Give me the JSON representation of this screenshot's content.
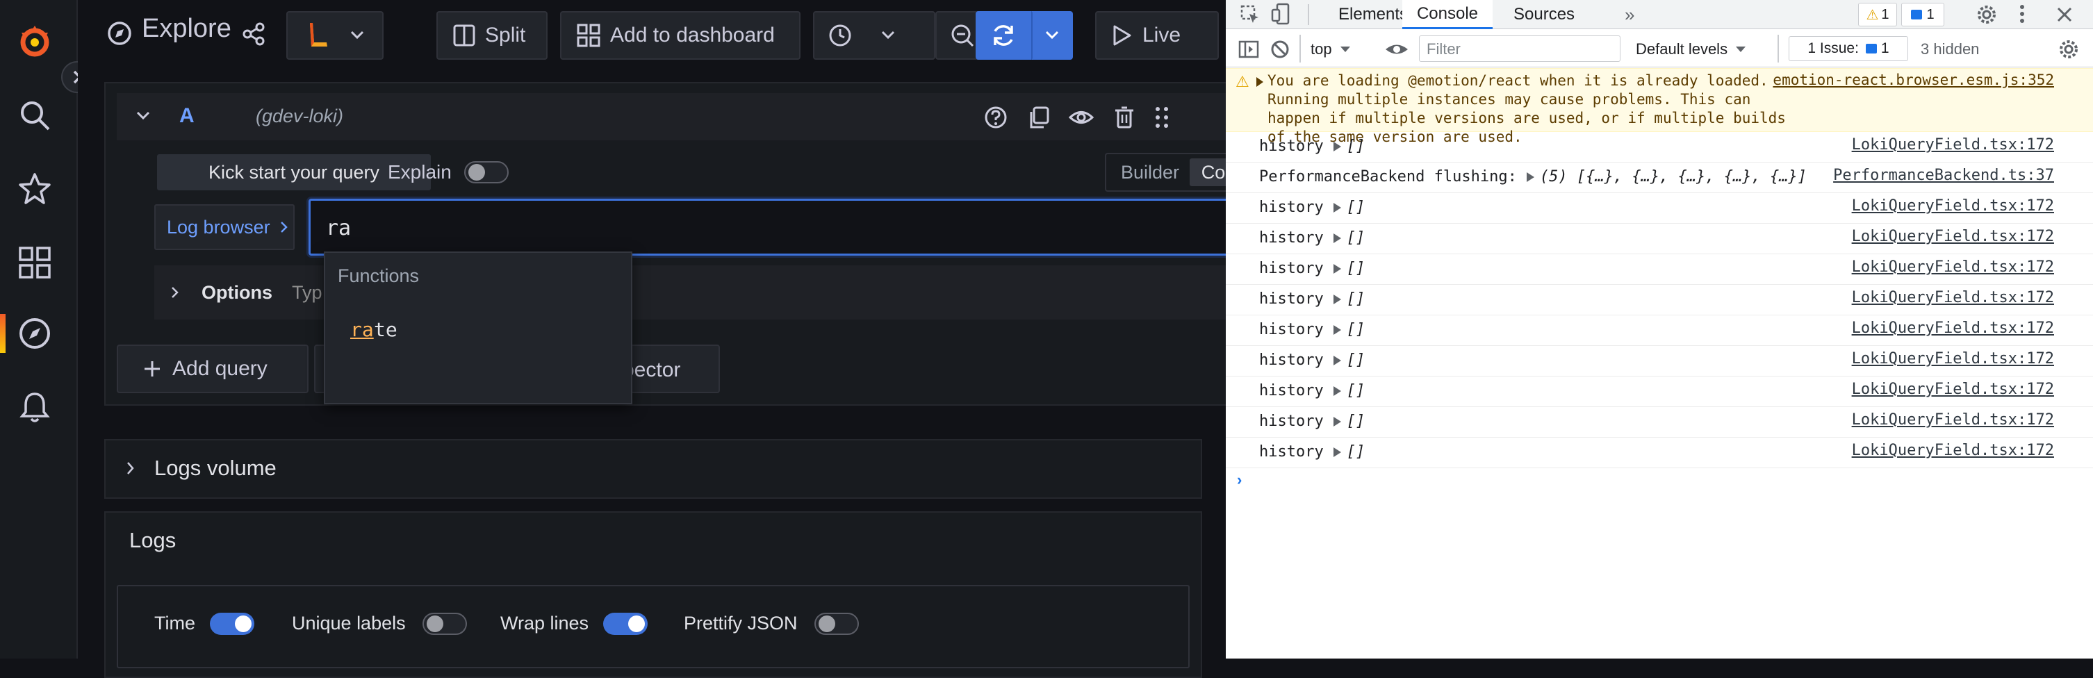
{
  "explore": {
    "title": "Explore",
    "datasource_icon": "loki-logo-icon",
    "split_label": "Split",
    "add_to_dashboard_label": "Add to dashboard",
    "live_label": "Live"
  },
  "query": {
    "ref_id": "A",
    "datasource": "(gdev-loki)",
    "kick_start_label": "Kick start your query",
    "explain_label": "Explain",
    "explain_on": false,
    "builder_label": "Builder",
    "code_label": "Code",
    "log_browser_label": "Log browser",
    "input_value": "ra",
    "options_label": "Options",
    "options_hint": "Typ",
    "add_query_label": "Add query",
    "inspector_label_tail": "pector"
  },
  "autocomplete": {
    "group": "Functions",
    "item_match": "ra",
    "item_rest": "te"
  },
  "logs_volume": {
    "label": "Logs volume"
  },
  "logs": {
    "title": "Logs",
    "options": [
      {
        "label": "Time",
        "on": true
      },
      {
        "label": "Unique labels",
        "on": false
      },
      {
        "label": "Wrap lines",
        "on": true
      },
      {
        "label": "Prettify JSON",
        "on": false
      }
    ]
  },
  "devtools": {
    "tabs": [
      "Elements",
      "Console",
      "Sources"
    ],
    "active_tab": "Console",
    "more_tabs": "»",
    "warning_count": "1",
    "message_count": "1",
    "context": "top",
    "filter_placeholder": "Filter",
    "levels": "Default levels",
    "issues_label": "1 Issue:",
    "issues_count": "1",
    "hidden": "3 hidden",
    "warning_text": "You are loading @emotion/react when it is already loaded. Running multiple instances may cause problems. This can happen if multiple versions are used, or if multiple builds of the same version are used.",
    "warning_source": "emotion-react.browser.esm.js:352",
    "logs": [
      {
        "label": "history",
        "value": "[]",
        "source": "LokiQueryField.tsx:172"
      },
      {
        "label": "PerformanceBackend flushing:",
        "value": "(5) [{…}, {…}, {…}, {…}, {…}]",
        "source": "PerformanceBackend.ts:37"
      },
      {
        "label": "history",
        "value": "[]",
        "source": "LokiQueryField.tsx:172"
      },
      {
        "label": "history",
        "value": "[]",
        "source": "LokiQueryField.tsx:172"
      },
      {
        "label": "history",
        "value": "[]",
        "source": "LokiQueryField.tsx:172"
      },
      {
        "label": "history",
        "value": "[]",
        "source": "LokiQueryField.tsx:172"
      },
      {
        "label": "history",
        "value": "[]",
        "source": "LokiQueryField.tsx:172"
      },
      {
        "label": "history",
        "value": "[]",
        "source": "LokiQueryField.tsx:172"
      },
      {
        "label": "history",
        "value": "[]",
        "source": "LokiQueryField.tsx:172"
      },
      {
        "label": "history",
        "value": "[]",
        "source": "LokiQueryField.tsx:172"
      },
      {
        "label": "history",
        "value": "[]",
        "source": "LokiQueryField.tsx:172"
      }
    ]
  },
  "colors": {
    "accent": "#3d71d9",
    "brand_orange": "#f05a28",
    "highlight": "#ffb357",
    "link_blue": "#6e9fff"
  }
}
